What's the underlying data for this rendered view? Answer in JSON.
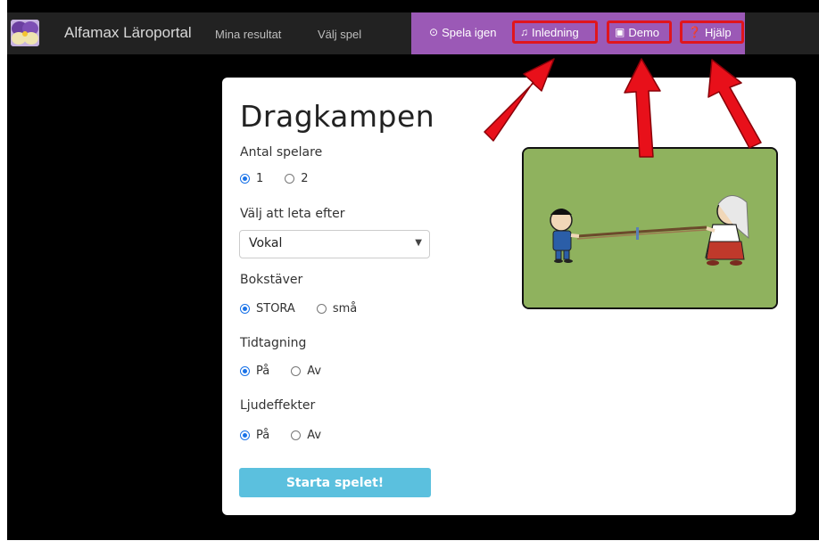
{
  "navbar": {
    "brand": "Alfamax Läroportal",
    "links": [
      "Mina resultat",
      "Välj spel"
    ],
    "game_buttons": [
      {
        "label": "Spela igen",
        "icon": "replay-icon"
      },
      {
        "label": "Inledning",
        "icon": "music-note-icon"
      },
      {
        "label": "Demo",
        "icon": "film-icon"
      },
      {
        "label": "Hjälp",
        "icon": "help-circle-icon"
      }
    ]
  },
  "game": {
    "title": "Dragkampen",
    "players": {
      "label": "Antal spelare",
      "options": [
        "1",
        "2"
      ],
      "selected": "1"
    },
    "search": {
      "label": "Välj att leta efter",
      "value": "Vokal"
    },
    "letters": {
      "label": "Bokstäver",
      "options": [
        "STORA",
        "små"
      ],
      "selected": "STORA"
    },
    "timing": {
      "label": "Tidtagning",
      "options": [
        "På",
        "Av"
      ],
      "selected": "På"
    },
    "sound": {
      "label": "Ljudeffekter",
      "options": [
        "På",
        "Av"
      ],
      "selected": "På"
    },
    "start_label": "Starta spelet!"
  },
  "colors": {
    "navbar": "#222222",
    "game_menu": "#9b59b6",
    "highlight": "#e0151d",
    "start_button": "#5bc0de",
    "illustration_bg": "#8fb25e"
  }
}
